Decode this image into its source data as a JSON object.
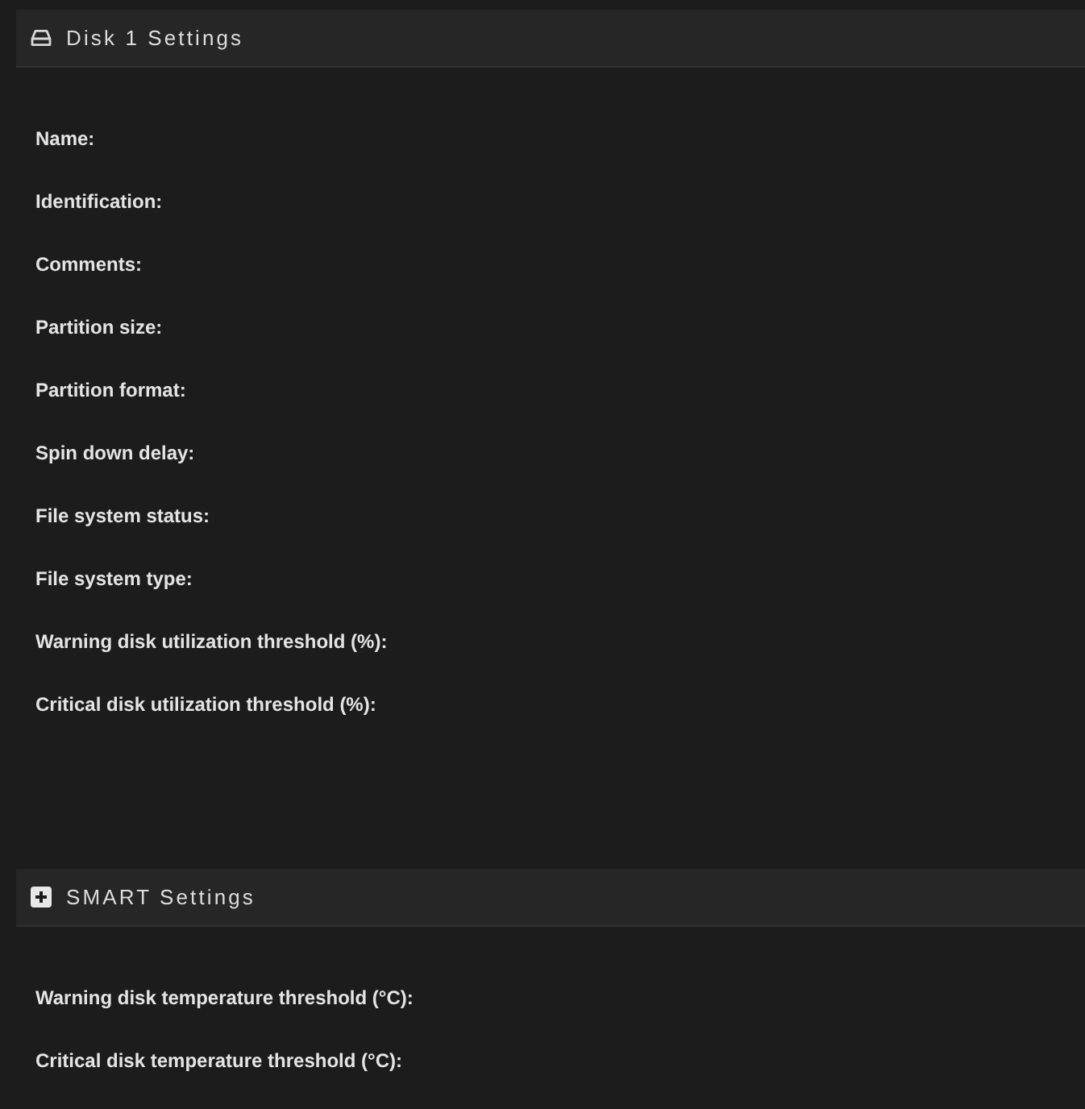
{
  "sections": [
    {
      "kind": "drive",
      "title": "Disk 1 Settings",
      "fields": [
        "Name:",
        "Identification:",
        "Comments:",
        "Partition size:",
        "Partition format:",
        "Spin down delay:",
        "File system status:",
        "File system type:",
        "Warning disk utilization threshold (%):",
        "Critical disk utilization threshold (%):"
      ]
    },
    {
      "kind": "expander",
      "title": "SMART Settings",
      "fields": [
        "Warning disk temperature threshold (°C):",
        "Critical disk temperature threshold (°C):"
      ]
    }
  ]
}
